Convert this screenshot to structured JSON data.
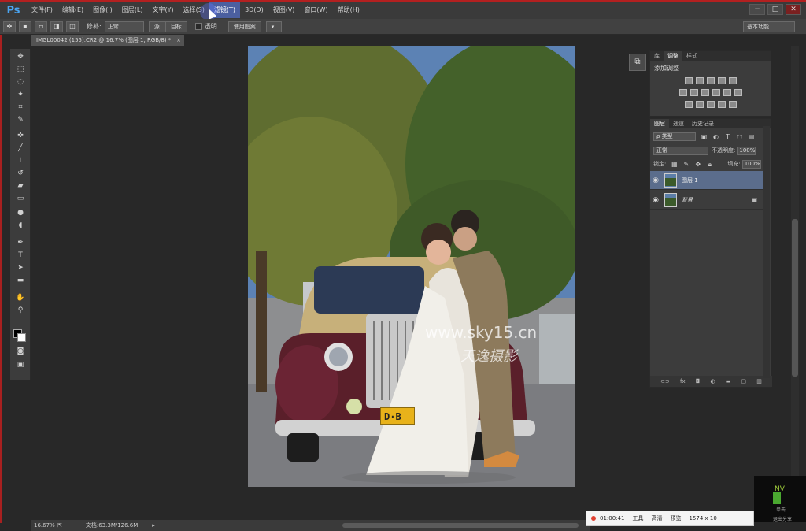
{
  "app": {
    "logo": "Ps"
  },
  "menu": {
    "items": [
      "文件(F)",
      "编辑(E)",
      "图像(I)",
      "图层(L)",
      "文字(Y)",
      "选择(S)",
      "滤镜(T)",
      "3D(D)",
      "视图(V)",
      "窗口(W)",
      "帮助(H)"
    ],
    "active_index": 6
  },
  "window": {
    "minimize": "−",
    "restore": "□",
    "close": "✕"
  },
  "options": {
    "tool_icon": "patch-tool-icon",
    "repair_label": "修补:",
    "repair_value": "正常",
    "source_label": "源",
    "target_label": "目标",
    "transparent_label": "透明",
    "use_pattern_label": "使用图案",
    "workspace": "基本功能"
  },
  "doc_tab": {
    "title": "IMGL00042 (155).CR2 @ 16.7% (图层 1, RGB/8) *",
    "close": "×"
  },
  "photo": {
    "watermark": "www.sky15.cn",
    "watermark_script": "天逸摄影",
    "plate": "D·B"
  },
  "status": {
    "zoom": "16.67%",
    "doc_info": "文档:63.3M/126.6M"
  },
  "adjust_panel": {
    "tabs": [
      "库",
      "调整",
      "样式"
    ],
    "active_tab": 1,
    "title": "添加调整"
  },
  "layers_panel": {
    "tabs": [
      "图层",
      "通道",
      "历史记录"
    ],
    "active_tab": 0,
    "filter_label": "ρ 类型",
    "blend_mode": "正常",
    "opacity_label": "不透明度:",
    "opacity_value": "100%",
    "lock_label": "锁定:",
    "fill_label": "填充:",
    "fill_value": "100%",
    "layers": [
      {
        "name": "图层 1",
        "selected": true,
        "locked": false
      },
      {
        "name": "背景",
        "selected": false,
        "locked": true
      }
    ],
    "footer_icons": [
      "link-icon",
      "fx-icon",
      "mask-icon",
      "adjustment-icon",
      "folder-icon",
      "new-layer-icon",
      "trash-icon"
    ],
    "footer_fx": "fx"
  },
  "recorder": {
    "time": "01:00:41",
    "tools": "工具",
    "quality": "高清",
    "preview": "预览",
    "resolution": "1574 x 10"
  },
  "nv_box": {
    "text": "NV",
    "label": "单击",
    "label2": "退出分享"
  },
  "colors": {
    "accent": "#4aa4f0",
    "selected_layer": "#5b6d8c",
    "border_red": "#b32020"
  }
}
